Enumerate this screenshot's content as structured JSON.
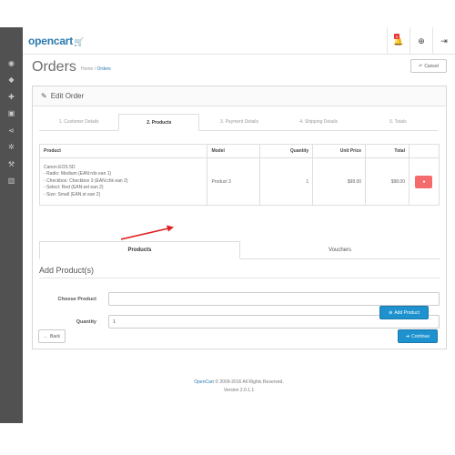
{
  "header": {
    "logo_text": "opencart",
    "logo_cart_glyph": "🛒",
    "notification_count": "5",
    "icons": [
      "menu-icon",
      "bell-icon",
      "life-ring-icon",
      "sign-out-icon"
    ]
  },
  "sidebar": {
    "icons": [
      "dashboard-icon",
      "tag-icon",
      "puzzle-icon",
      "shopping-cart-icon",
      "share-icon",
      "cog-icon",
      "wrench-icon",
      "bar-chart-icon"
    ]
  },
  "page": {
    "title": "Orders",
    "breadcrumb": [
      "Home",
      "Orders"
    ],
    "breadcrumb_sep": "/",
    "cancel_label": "Cancel"
  },
  "panel": {
    "heading": "Edit Order",
    "steps": [
      "1. Customer Details",
      "2. Products",
      "3. Payment Details",
      "4. Shipping Details",
      "5. Totals"
    ],
    "active_step": 1
  },
  "products_table": {
    "columns": [
      "Product",
      "Model",
      "Quantity",
      "Unit Price",
      "Total",
      ""
    ],
    "rows": [
      {
        "name": "Canon EOS 5D",
        "options": [
          "- Radio: Medium (EAN:rdo ean 1)",
          "- Checkbox: Checkbox 3 (EAN:chk ean 2)",
          "- Select: Red (EAN:sel ean 2)",
          "- Size: Small (EAN:st ean 2)"
        ],
        "model": "Product 3",
        "quantity": "1",
        "unit_price": "$98.00",
        "total": "$98.00"
      }
    ]
  },
  "sub_tabs": [
    "Products",
    "Vouchers"
  ],
  "add_product": {
    "title": "Add Product(s)",
    "choose_label": "Choose Product",
    "choose_value": "",
    "quantity_label": "Quantity",
    "quantity_value": "1",
    "button_label": "Add Product"
  },
  "actions": {
    "back_label": "Back",
    "continue_label": "Continue"
  },
  "footer": {
    "brand": "OpenCart",
    "copyright": "© 2009-2016 All Rights Reserved.",
    "version": "Version 2.0.1.1"
  },
  "colors": {
    "primary": "#1e91cf",
    "danger": "#f56b6b",
    "sidebar": "#515151",
    "arrow": "#e02020"
  }
}
